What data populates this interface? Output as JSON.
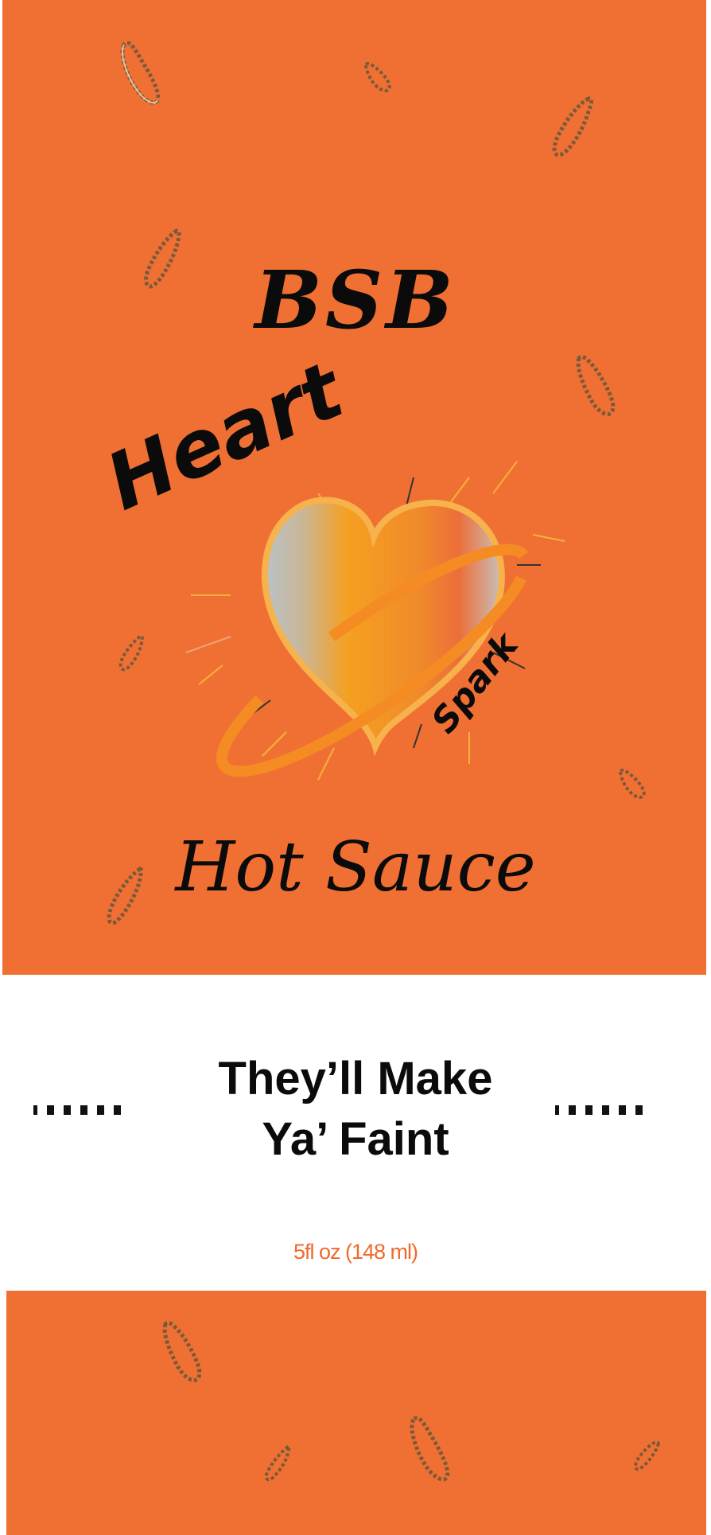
{
  "label": {
    "brand": "BSB",
    "title_word_1": "Heart",
    "title_word_2": "Spark",
    "product": "Hot Sauce",
    "tagline_line_1": "They’ll Make",
    "tagline_line_2": "Ya’ Faint",
    "volume": "5fl oz (148 ml)"
  },
  "colors": {
    "background_orange": "#f07033",
    "heart_ring_orange": "#f58b23",
    "text_black": "#0b0b0b",
    "volume_orange": "#ef6a2c"
  },
  "icons": [
    "chili-pepper-icon",
    "heart-icon",
    "ring-icon",
    "spark-rays-icon"
  ]
}
